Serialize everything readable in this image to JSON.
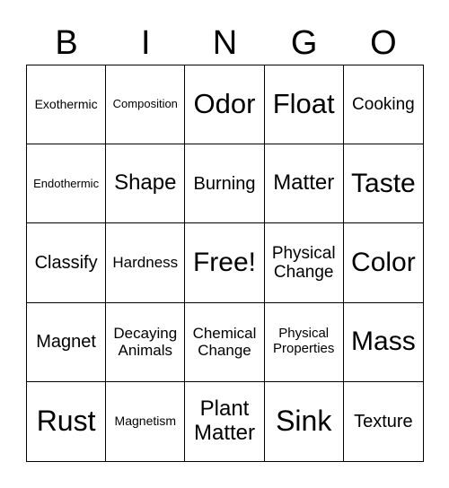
{
  "header": [
    "B",
    "I",
    "N",
    "G",
    "O"
  ],
  "cells": [
    {
      "text": "Exothermic",
      "size": 14
    },
    {
      "text": "Composition",
      "size": 13
    },
    {
      "text": "Odor",
      "size": 31
    },
    {
      "text": "Float",
      "size": 31
    },
    {
      "text": "Cooking",
      "size": 19
    },
    {
      "text": "Endothermic",
      "size": 13
    },
    {
      "text": "Shape",
      "size": 24
    },
    {
      "text": "Burning",
      "size": 20
    },
    {
      "text": "Matter",
      "size": 24
    },
    {
      "text": "Taste",
      "size": 30
    },
    {
      "text": "Classify",
      "size": 20
    },
    {
      "text": "Hardness",
      "size": 17
    },
    {
      "text": "Free!",
      "size": 30
    },
    {
      "text": "Physical Change",
      "size": 19
    },
    {
      "text": "Color",
      "size": 30
    },
    {
      "text": "Magnet",
      "size": 20
    },
    {
      "text": "Decaying Animals",
      "size": 17
    },
    {
      "text": "Chemical Change",
      "size": 17
    },
    {
      "text": "Physical Properties",
      "size": 15
    },
    {
      "text": "Mass",
      "size": 30
    },
    {
      "text": "Rust",
      "size": 32
    },
    {
      "text": "Magnetism",
      "size": 14
    },
    {
      "text": "Plant Matter",
      "size": 24
    },
    {
      "text": "Sink",
      "size": 32
    },
    {
      "text": "Texture",
      "size": 20
    }
  ]
}
